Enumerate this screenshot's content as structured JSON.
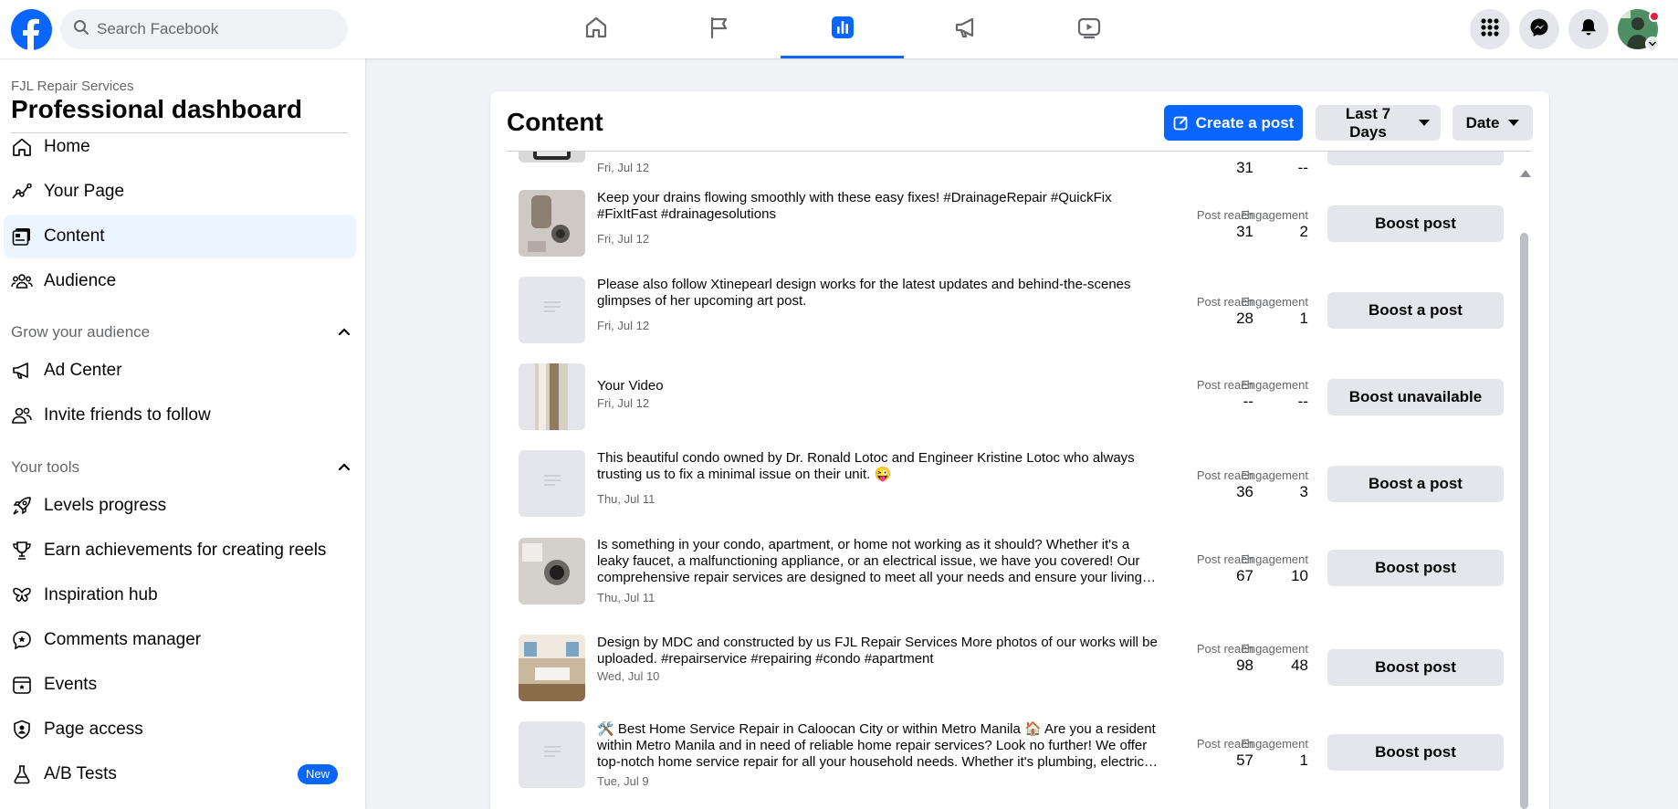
{
  "topbar": {
    "search_placeholder": "Search Facebook",
    "nav_tabs": [
      {
        "icon": "home-icon",
        "active": false
      },
      {
        "icon": "flag-icon",
        "active": false
      },
      {
        "icon": "insights-chart-icon",
        "active": true
      },
      {
        "icon": "megaphone-icon",
        "active": false
      },
      {
        "icon": "video-icon",
        "active": false
      }
    ],
    "right_icons": [
      "grid-menu-icon",
      "messenger-icon",
      "bell-icon",
      "profile-avatar"
    ]
  },
  "sidebar": {
    "page_name": "FJL Repair Services",
    "title": "Professional dashboard",
    "main_items": [
      {
        "label": "Home",
        "icon": "home-outline-icon"
      },
      {
        "label": "Your Page",
        "icon": "trend-line-icon"
      },
      {
        "label": "Content",
        "icon": "content-library-icon",
        "active": true
      },
      {
        "label": "Audience",
        "icon": "people-icon"
      }
    ],
    "grow_section": {
      "label": "Grow your audience",
      "items": [
        {
          "label": "Ad Center",
          "icon": "megaphone-outline-icon"
        },
        {
          "label": "Invite friends to follow",
          "icon": "add-friends-icon"
        }
      ]
    },
    "tools_section": {
      "label": "Your tools",
      "items": [
        {
          "label": "Levels progress",
          "icon": "rocket-icon"
        },
        {
          "label": "Earn achievements for creating reels",
          "icon": "trophy-icon"
        },
        {
          "label": "Inspiration hub",
          "icon": "butterfly-icon"
        },
        {
          "label": "Comments manager",
          "icon": "comment-star-icon"
        },
        {
          "label": "Events",
          "icon": "calendar-icon"
        },
        {
          "label": "Page access",
          "icon": "user-shield-icon"
        },
        {
          "label": "A/B Tests",
          "icon": "flask-icon",
          "badge": "New"
        }
      ]
    }
  },
  "content": {
    "title": "Content",
    "create_post_label": "Create a post",
    "range_filter": "Last 7 Days",
    "sort_filter": "Date",
    "partial_row": {
      "date": "Fri, Jul 12",
      "post_reach": "31",
      "engagement": "--"
    },
    "metric_labels": {
      "reach": "Post reach",
      "engagement": "Engagement"
    },
    "posts": [
      {
        "text": "Keep your drains flowing smoothly with these easy fixes! #DrainageRepair #QuickFix #FixItFast #drainagesolutions",
        "date": "Fri, Jul 12",
        "post_reach": "31",
        "engagement": "2",
        "button": "Boost post",
        "thumb": "photo-drain"
      },
      {
        "text": "Please also follow Xtinepearl design works for the latest updates and behind-the-scenes glimpses of her upcoming art post.",
        "date": "Fri, Jul 12",
        "post_reach": "28",
        "engagement": "1",
        "button": "Boost a post",
        "thumb": "text-placeholder"
      },
      {
        "text": "Your Video",
        "date": "Fri, Jul 12",
        "post_reach": "--",
        "engagement": "--",
        "button": "Boost unavailable",
        "thumb": "video-vertical"
      },
      {
        "text": "This beautiful condo owned by Dr. Ronald Lotoc and Engineer Kristine Lotoc who always trusting us to fix a minimal issue on their unit. 😜",
        "date": "Thu, Jul 11",
        "post_reach": "36",
        "engagement": "3",
        "button": "Boost a post",
        "thumb": "text-placeholder"
      },
      {
        "text": "Is something in your condo, apartment, or home not working as it should? Whether it's a leaky faucet, a malfunctioning appliance, or an electrical issue, we have you covered! Our comprehensive repair services are designed to meet all your needs and ensure your living space is comfortable.",
        "date": "Thu, Jul 11",
        "post_reach": "67",
        "engagement": "10",
        "button": "Boost post",
        "thumb": "photo-drain-floor"
      },
      {
        "text": "Design by MDC and constructed by us FJL Repair Services More photos of our works will be uploaded. #repairservice #repairing #condo #apartment",
        "date": "Wed, Jul 10",
        "post_reach": "98",
        "engagement": "48",
        "button": "Boost post",
        "thumb": "photo-interior"
      },
      {
        "text": "🛠️ Best Home Service Repair in Caloocan City or within Metro Manila 🏠 Are you a resident within Metro Manila and in need of reliable home repair services? Look no further! We offer top-notch home service repair for all your household needs. Whether it's plumbing, electrical, or appliance repair, we've got you covered.",
        "date": "Tue, Jul 9",
        "post_reach": "57",
        "engagement": "1",
        "button": "Boost post",
        "thumb": "text-placeholder"
      }
    ]
  },
  "colors": {
    "accent": "#0866ff",
    "active_bg": "#ebf5ff",
    "button_gray": "#e4e6eb",
    "page_bg": "#f0f2f5"
  }
}
